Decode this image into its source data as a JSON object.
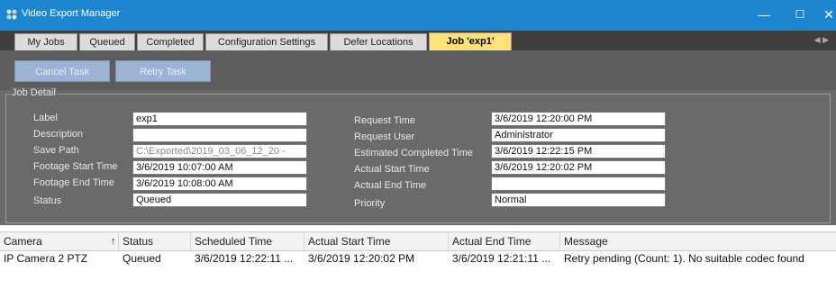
{
  "window": {
    "title": "Video Export Manager",
    "icon": "app-logo-icon",
    "controls": {
      "minimize": "—",
      "maximize": "☐",
      "close": "✕"
    }
  },
  "tabs": [
    {
      "label": "My Jobs",
      "active": false
    },
    {
      "label": "Queued",
      "active": false
    },
    {
      "label": "Completed",
      "active": false
    },
    {
      "label": "Configuration Settings",
      "active": false
    },
    {
      "label": "Defer Locations",
      "active": false
    },
    {
      "label": "Job 'exp1'",
      "active": true
    }
  ],
  "toolbar": {
    "cancel_label": "Cancel Task",
    "retry_label": "Retry Task"
  },
  "job_detail": {
    "title": "Job Detail",
    "left": {
      "label_label": "Label",
      "label_value": "exp1",
      "description_label": "Description",
      "description_value": "",
      "save_path_label": "Save Path",
      "save_path_value": "C:\\Exported\\2019_03_06_12_20 -",
      "footage_start_label": "Footage Start Time",
      "footage_start_value": "3/6/2019 10:07:00 AM",
      "footage_end_label": "Footage End Time",
      "footage_end_value": "3/6/2019 10:08:00 AM",
      "status_label": "Status",
      "status_value": "Queued"
    },
    "right": {
      "request_time_label": "Request Time",
      "request_time_value": "3/6/2019 12:20:00 PM",
      "request_user_label": "Request User",
      "request_user_value": "Administrator",
      "est_completed_label": "Estimated Completed Time",
      "est_completed_value": "3/6/2019 12:22:15 PM",
      "actual_start_label": "Actual Start Time",
      "actual_start_value": "3/6/2019 12:20:02 PM",
      "actual_end_label": "Actual End Time",
      "actual_end_value": "",
      "priority_label": "Priority",
      "priority_value": "Normal"
    }
  },
  "grid": {
    "columns": [
      "Camera",
      "Status",
      "Scheduled Time",
      "Actual Start Time",
      "Actual End Time",
      "Message"
    ],
    "sort_glyph": "↑",
    "rows": [
      {
        "camera": "IP Camera 2 PTZ",
        "status": "Queued",
        "scheduled": "3/6/2019 12:22:11 ...",
        "actual_start": "3/6/2019 12:20:02 PM",
        "actual_end": "3/6/2019 12:21:11 ...",
        "message": "Retry pending (Count: 1). No suitable codec found"
      }
    ]
  },
  "colors": {
    "titlebar": "#1c86d0",
    "active_tab": "#ffe27a",
    "workspace": "#6a6a6a"
  }
}
